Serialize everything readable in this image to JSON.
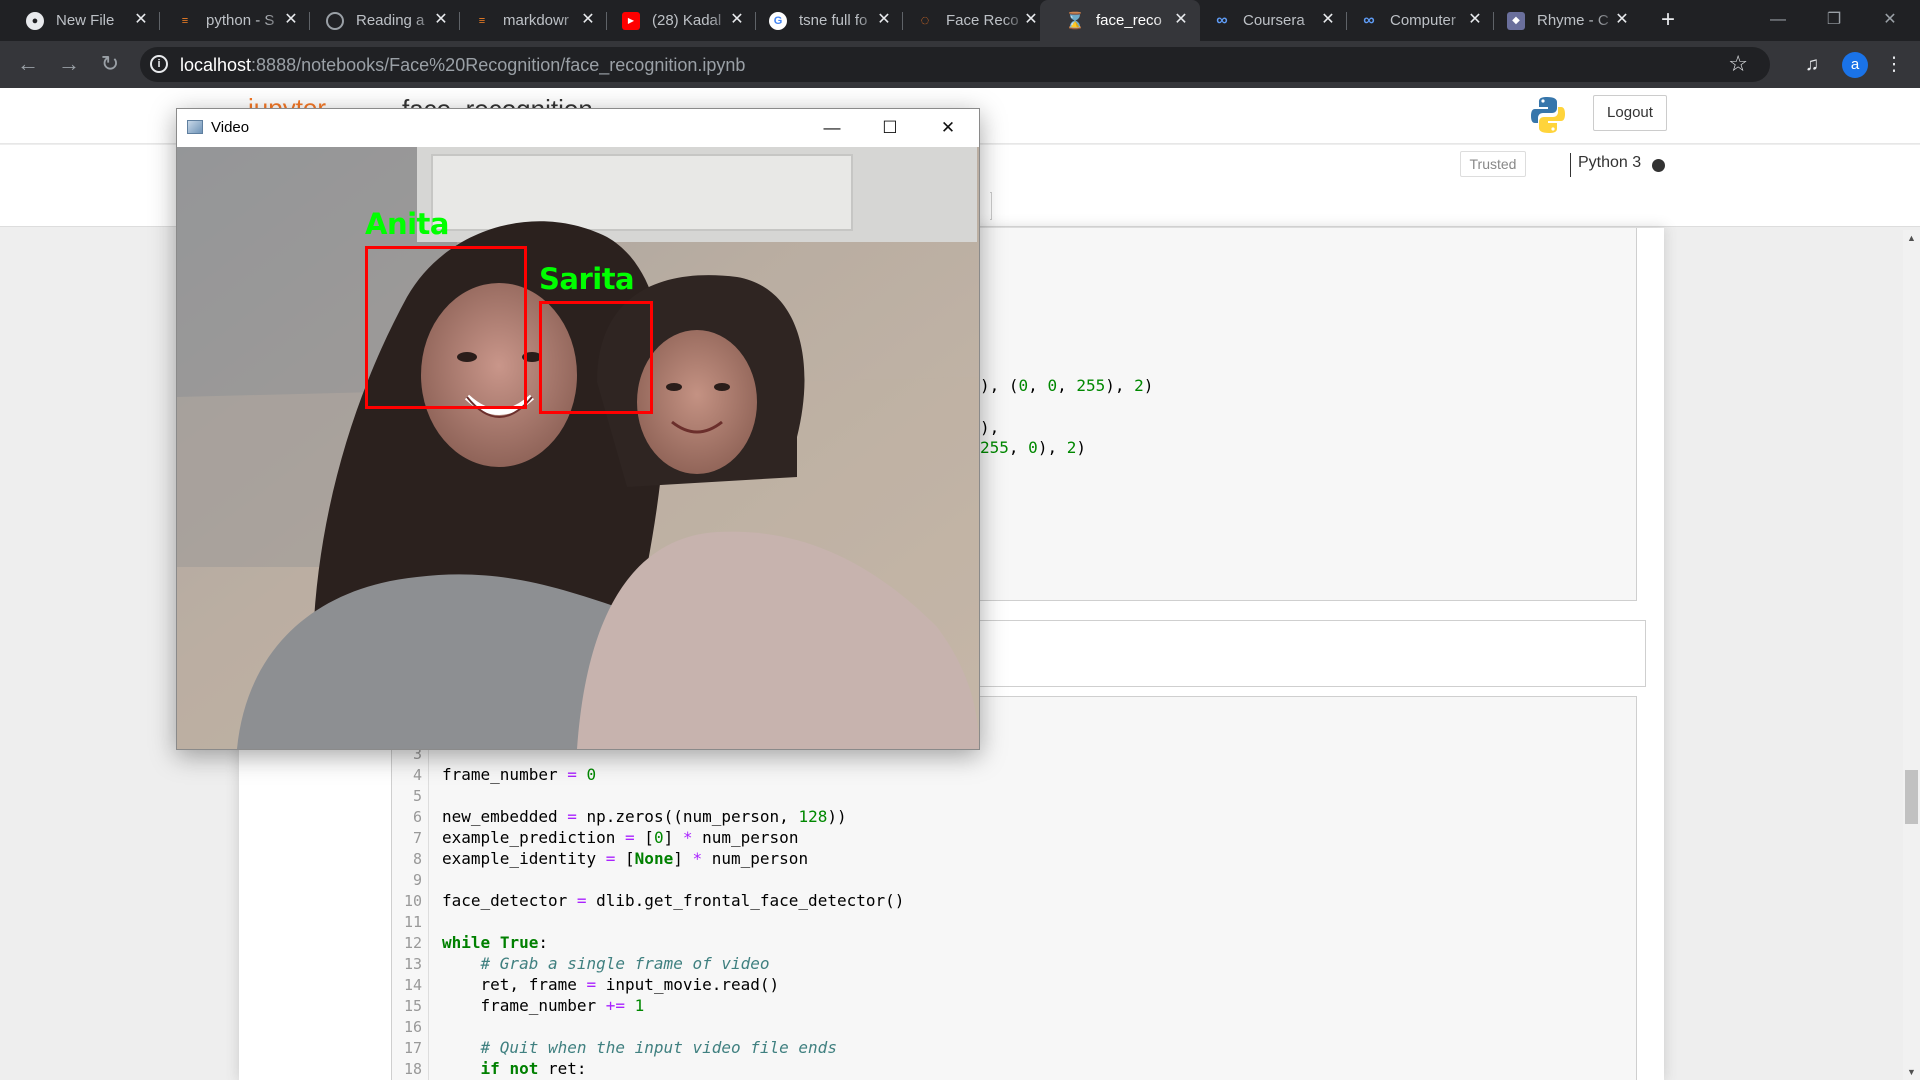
{
  "browser": {
    "tabs": [
      {
        "title": "New File",
        "icon": "github-icon",
        "active": false
      },
      {
        "title": "python - S",
        "icon": "stackoverflow-icon",
        "active": false
      },
      {
        "title": "Reading a",
        "icon": "globe-icon",
        "active": false
      },
      {
        "title": "markdowr",
        "icon": "stackoverflow-icon",
        "active": false
      },
      {
        "title": "(28) Kadal",
        "icon": "youtube-icon",
        "active": false
      },
      {
        "title": "tsne full fo",
        "icon": "google-icon",
        "active": false
      },
      {
        "title": "Face Reco",
        "icon": "jupyter-icon",
        "active": false
      },
      {
        "title": "face_reco",
        "icon": "hourglass-icon",
        "active": true
      },
      {
        "title": "Coursera",
        "icon": "coursera-icon",
        "active": false
      },
      {
        "title": "Computer",
        "icon": "coursera-icon",
        "active": false
      },
      {
        "title": "Rhyme - C",
        "icon": "rhyme-icon",
        "active": false
      }
    ],
    "url_host": "localhost",
    "url_path": ":8888/notebooks/Face%20Recognition/face_recognition.ipynb",
    "profile_initial": "a"
  },
  "jupyter": {
    "logo_text": "jupyter",
    "notebook_name": "face_recognition",
    "logout_label": "Logout",
    "trusted_label": "Trusted",
    "kernel_name": "Python 3"
  },
  "cell1_fragments": {
    "line1_a": "), (",
    "line1_b": "0",
    "line1_c": ", ",
    "line1_d": "0",
    "line1_e": ", ",
    "line1_f": "255",
    "line1_g": "), ",
    "line1_h": "2",
    "line1_i": ")",
    "line2": "),",
    "line3_a": "255",
    "line3_b": ", ",
    "line3_c": "0",
    "line3_d": "), ",
    "line3_e": "2",
    "line3_f": ")"
  },
  "code": {
    "line_numbers": [
      "3",
      "4",
      "5",
      "6",
      "7",
      "8",
      "9",
      "10",
      "11",
      "12",
      "13",
      "14",
      "15",
      "16",
      "17",
      "18"
    ],
    "l4_a": "frame_number ",
    "l4_op": "=",
    "l4_b": " ",
    "l4_num": "0",
    "l6_a": "new_embedded ",
    "l6_op": "=",
    "l6_b": " np.zeros((num_person, ",
    "l6_num": "128",
    "l6_c": "))",
    "l7_a": "example_prediction ",
    "l7_op": "=",
    "l7_b": " [",
    "l7_num": "0",
    "l7_c": "] ",
    "l7_op2": "*",
    "l7_d": " num_person",
    "l8_a": "example_identity ",
    "l8_op": "=",
    "l8_b": " [",
    "l8_kw": "None",
    "l8_c": "] ",
    "l8_op2": "*",
    "l8_d": " num_person",
    "l10_a": "face_detector ",
    "l10_op": "=",
    "l10_b": " dlib.get_frontal_face_detector()",
    "l12_kw": "while",
    "l12_a": " ",
    "l12_kw2": "True",
    "l12_b": ":",
    "l13_cm": "    # Grab a single frame of video",
    "l14_a": "    ret, frame ",
    "l14_op": "=",
    "l14_b": " input_movie.read()",
    "l15_a": "    frame_number ",
    "l15_op": "+=",
    "l15_b": " ",
    "l15_num": "1",
    "l17_cm": "    # Quit when the input video file ends",
    "l18_a": "    ",
    "l18_kw": "if",
    "l18_b": " ",
    "l18_op": "not",
    "l18_c": " ret:"
  },
  "video_window": {
    "title": "Video",
    "faces": [
      {
        "name": "Anita"
      },
      {
        "name": "Sarita"
      }
    ]
  },
  "colors": {
    "tabstrip_bg": "#202124",
    "toolbar_bg": "#35363a",
    "box_color": "#ff0000",
    "label_color": "#00ff00",
    "jupyter_orange": "#f37726"
  }
}
